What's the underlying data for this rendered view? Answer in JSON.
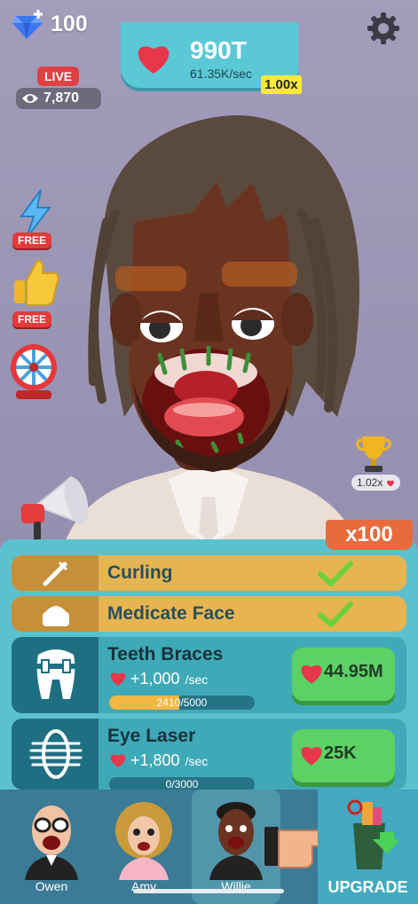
{
  "hud": {
    "gem_count": "100",
    "score": "990T",
    "score_rate": "61.35K/sec",
    "multiplier": "1.00x",
    "live_label": "LIVE",
    "viewer_count": "7,870"
  },
  "side_buttons": {
    "energy_free_label": "FREE",
    "like_free_label": "FREE"
  },
  "trophy": {
    "bonus": "1.02x"
  },
  "buy_multiplier": "x100",
  "upgrades": {
    "completed": [
      {
        "label": "Curling",
        "icon": "curling-iron-icon"
      },
      {
        "label": "Medicate Face",
        "icon": "cream-jar-icon"
      }
    ],
    "available": [
      {
        "label": "Teeth Braces",
        "icon": "tooth-braces-icon",
        "rate": "+1,000",
        "unit": "/sec",
        "progress_current": "2410",
        "progress_total": "/5000",
        "progress_fraction": 0.482,
        "cost": "44.95M"
      },
      {
        "label": "Eye Laser",
        "icon": "eye-laser-icon",
        "rate": "+1,800",
        "unit": "/sec",
        "progress_current": "0",
        "progress_total": "/3000",
        "progress_fraction": 0,
        "cost": "25K"
      }
    ]
  },
  "tabs": [
    {
      "label": "Owen"
    },
    {
      "label": "Amy"
    },
    {
      "label": "Willie"
    }
  ],
  "upgrade_button": {
    "label": "UPGRADE"
  },
  "colors": {
    "panel": "#5cc1cf",
    "completed_row": "#e6b552",
    "upgrade_row": "#3fa9b8",
    "buy_button": "#5cd164",
    "heart": "#e8364a"
  }
}
